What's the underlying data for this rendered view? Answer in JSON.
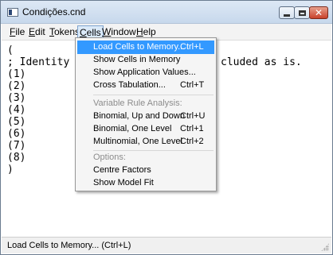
{
  "window": {
    "title": "Condições.cnd",
    "close_glyph": "✕"
  },
  "menubar": {
    "items": [
      {
        "key": "F",
        "rest": "ile"
      },
      {
        "key": "E",
        "rest": "dit"
      },
      {
        "key": "T",
        "rest": "okens"
      },
      {
        "key": "C",
        "rest": "ells"
      },
      {
        "key": "W",
        "rest": "indow"
      },
      {
        "key": "H",
        "rest": "elp"
      }
    ],
    "active_index": 3
  },
  "editor": {
    "lines": [
      "(",
      "; Identity",
      "(1)",
      "(2)",
      "(3)",
      "(4)",
      "(5)",
      "(6)",
      "(7)",
      "(8)",
      ")"
    ],
    "line1_tail": "cluded as is."
  },
  "cells_menu": {
    "items": [
      {
        "label": "Load Cells to Memory...",
        "shortcut": "Ctrl+L",
        "state": "highlighted"
      },
      {
        "label": "Show Cells in Memory",
        "shortcut": "",
        "state": "normal"
      },
      {
        "label": "Show Application Values...",
        "shortcut": "",
        "state": "normal"
      },
      {
        "label": "Cross Tabulation...",
        "shortcut": "Ctrl+T",
        "state": "normal"
      },
      {
        "label": "Variable Rule Analysis:",
        "shortcut": "",
        "state": "disabled"
      },
      {
        "label": "Binomial, Up and Down",
        "shortcut": "Ctrl+U",
        "state": "normal"
      },
      {
        "label": "Binomial, One Level",
        "shortcut": "Ctrl+1",
        "state": "normal"
      },
      {
        "label": "Multinomial, One Level",
        "shortcut": "Ctrl+2",
        "state": "normal"
      },
      {
        "label": "Options:",
        "shortcut": "",
        "state": "disabled"
      },
      {
        "label": "Centre Factors",
        "shortcut": "",
        "state": "normal"
      },
      {
        "label": "Show Model Fit",
        "shortcut": "",
        "state": "normal"
      }
    ]
  },
  "statusbar": {
    "text": "Load Cells to Memory... (Ctrl+L)"
  },
  "colors": {
    "highlight": "#3399ff",
    "disabled_text": "#8c8c8c",
    "close_button": "#c9412a",
    "titlebar": "#c7d8ec"
  }
}
